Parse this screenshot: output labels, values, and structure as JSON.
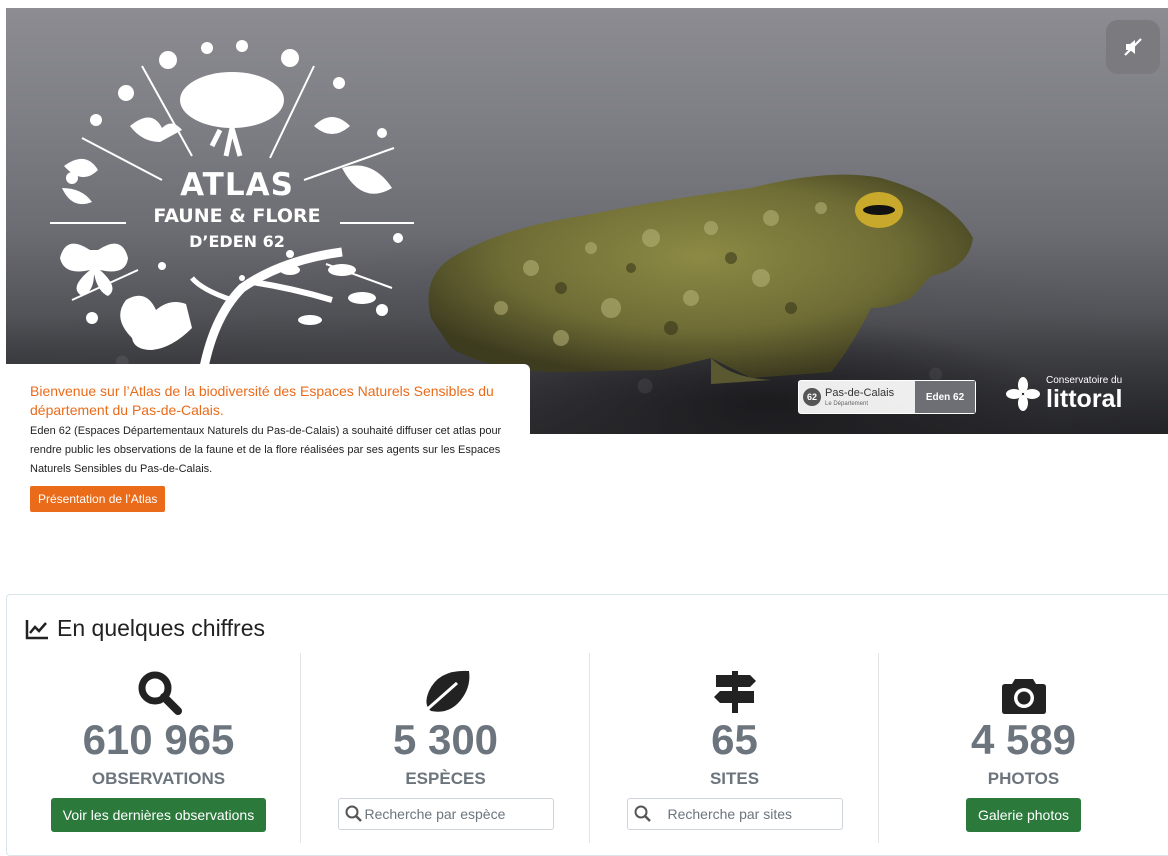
{
  "hero": {
    "logo": {
      "line1": "ATLAS",
      "line2": "FAUNE & FLORE",
      "line3": "D’EDEN 62"
    },
    "mute_icon": "mute-icon",
    "partner_logos": {
      "pdc_number": "62",
      "pdc_name": "Pas-de-Calais",
      "pdc_sub": "Le Département",
      "eden": "Eden 62",
      "cdl_small": "Conservatoire du",
      "cdl_big": "littoral"
    }
  },
  "welcome": {
    "title": "Bienvenue sur l’Atlas de la biodiversité des Espaces Naturels Sensibles du département du Pas-de-Calais.",
    "description": "Eden 62 (Espaces Départementaux Naturels du Pas-de-Calais) a souhaité diffuser cet atlas pour rendre public les observations de la faune et de la flore réalisées par ses agents sur les Espaces Naturels Sensibles du Pas-de-Calais.",
    "button": "Présentation de l’Atlas"
  },
  "stats": {
    "title": "En quelques chiffres",
    "title_icon": "chart-line-icon",
    "observations": {
      "value": "610 965",
      "label": "OBSERVATIONS",
      "button": "Voir les dernières observations",
      "icon": "search-icon"
    },
    "especes": {
      "value": "5 300",
      "label": "ESPÈCES",
      "placeholder": "Recherche par espèce",
      "icon": "leaf-icon"
    },
    "sites": {
      "value": "65",
      "label": "SITES",
      "placeholder": "Recherche par sites",
      "icon": "signpost-icon"
    },
    "photos": {
      "value": "4 589",
      "label": "PHOTOS",
      "button": "Galerie photos",
      "icon": "camera-icon"
    }
  },
  "colors": {
    "accent_orange": "#ea6b1a",
    "button_green": "#2b7a3c",
    "stat_gray": "#6c757d"
  }
}
